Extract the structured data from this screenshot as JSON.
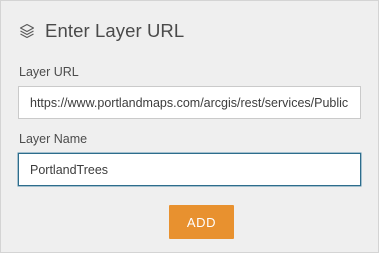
{
  "dialog": {
    "title": "Enter Layer URL",
    "icon": "layers-icon"
  },
  "fields": {
    "url": {
      "label": "Layer URL",
      "value": "https://www.portlandmaps.com/arcgis/rest/services/Public"
    },
    "name": {
      "label": "Layer Name",
      "value": "PortlandTrees"
    }
  },
  "actions": {
    "add_label": "ADD"
  },
  "colors": {
    "accent": "#e8912f",
    "focus_border": "#2d6d8c",
    "panel_background": "#efefef"
  }
}
